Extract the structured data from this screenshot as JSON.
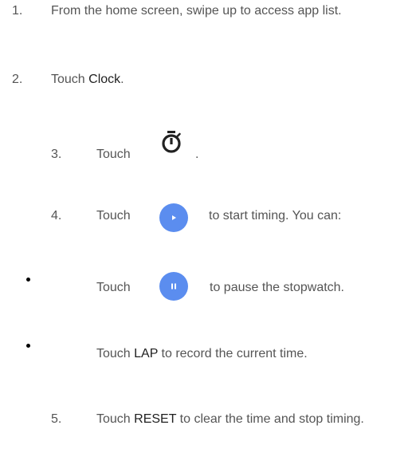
{
  "steps": [
    {
      "number": "1.",
      "text": "From the home screen, swipe up to access app list."
    },
    {
      "number": "2.",
      "pre": "Touch ",
      "bold": "Clock",
      "post": "."
    },
    {
      "number": "3.",
      "pre": "Touch",
      "post": ".",
      "icon": "stopwatch-icon"
    },
    {
      "number": "4.",
      "pre": "Touch",
      "post": "to start timing. You can:",
      "icon": "play-icon"
    },
    {
      "bullet": true,
      "pre": "Touch",
      "post": "to pause the stopwatch.",
      "icon": "pause-icon"
    },
    {
      "bullet": true,
      "pre": "Touch ",
      "bold": "LAP",
      "post": " to record the current time."
    },
    {
      "number": "5.",
      "pre": "Touch ",
      "bold": "RESET",
      "post": " to clear the time and stop timing."
    }
  ],
  "colors": {
    "accent": "#5b8def",
    "text": "#555555",
    "bold_text": "#1f1f1f"
  }
}
